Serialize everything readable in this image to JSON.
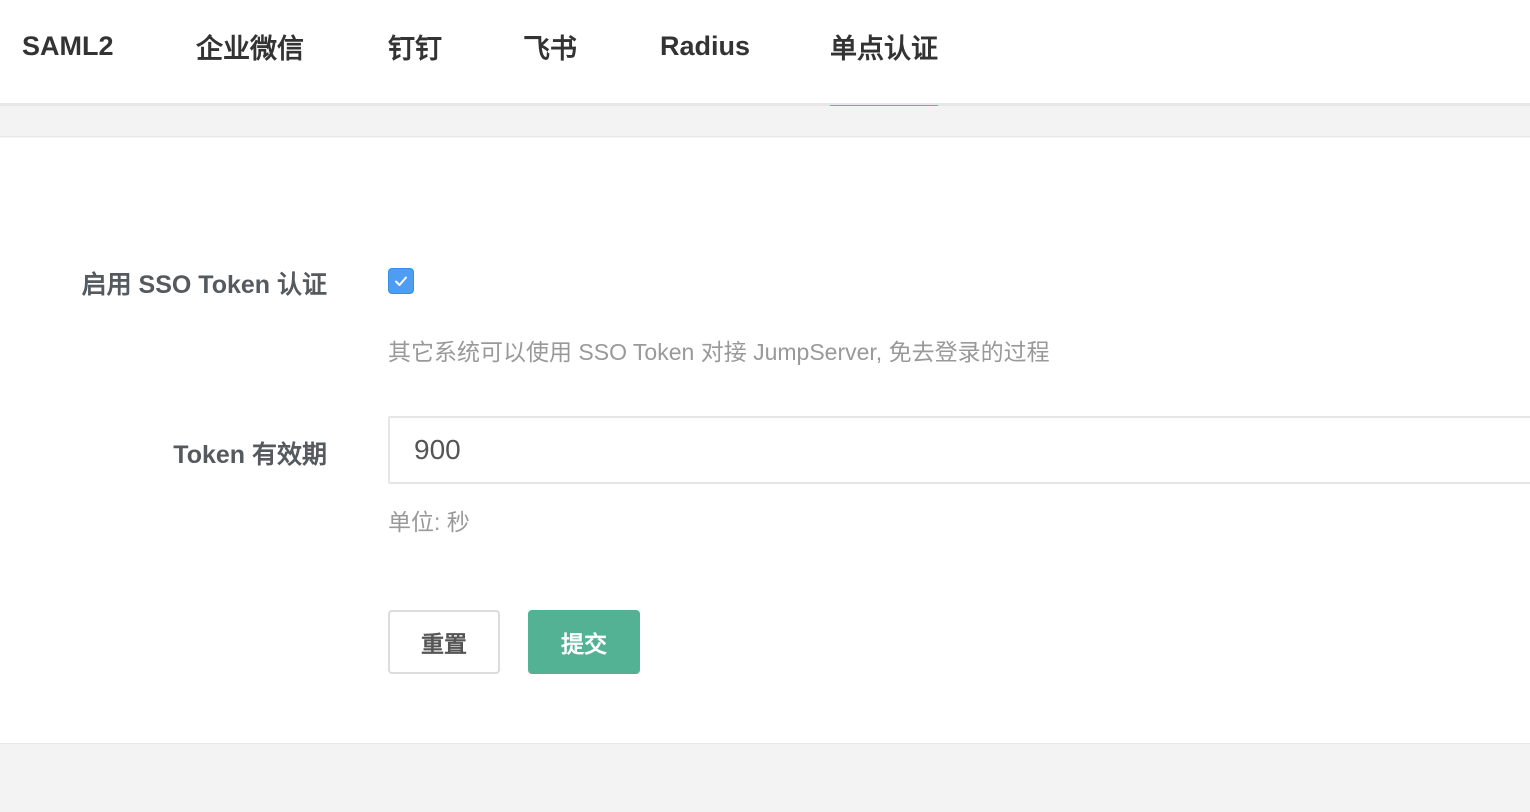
{
  "tabs": [
    {
      "label": "SAML2",
      "active": false
    },
    {
      "label": "企业微信",
      "active": false
    },
    {
      "label": "钉钉",
      "active": false
    },
    {
      "label": "飞书",
      "active": false
    },
    {
      "label": "Radius",
      "active": false
    },
    {
      "label": "单点认证",
      "active": true
    }
  ],
  "form": {
    "sso_enable": {
      "label": "启用 SSO Token 认证",
      "checked": true,
      "help": "其它系统可以使用 SSO Token 对接 JumpServer, 免去登录的过程"
    },
    "token_ttl": {
      "label": "Token 有效期",
      "value": "900",
      "help": "单位: 秒"
    },
    "reset_label": "重置",
    "submit_label": "提交"
  },
  "colors": {
    "accent": "#1ab394",
    "checkbox": "#4f9df3",
    "submit": "#52b293"
  }
}
